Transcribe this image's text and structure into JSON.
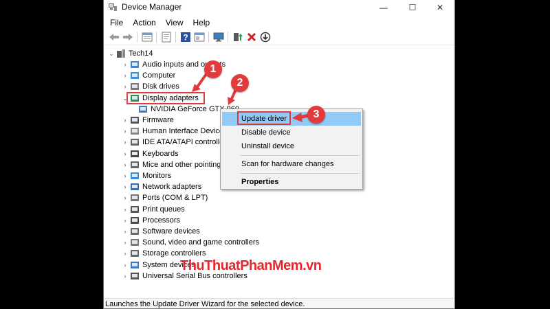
{
  "window": {
    "title": "Device Manager",
    "minimize_glyph": "—",
    "maximize_glyph": "☐",
    "close_glyph": "✕"
  },
  "menu": [
    "File",
    "Action",
    "View",
    "Help"
  ],
  "toolbar": {
    "icons": [
      "back-icon",
      "forward-icon",
      "properties-icon",
      "view-icon",
      "help-icon",
      "view-icon-2",
      "monitor-icon",
      "update-driver-icon",
      "uninstall-icon",
      "download-icon"
    ]
  },
  "tree": {
    "root": "Tech14",
    "items": [
      {
        "label": "Audio inputs and outputs",
        "chevron": "›"
      },
      {
        "label": "Computer",
        "chevron": "›"
      },
      {
        "label": "Disk drives",
        "chevron": "›"
      },
      {
        "label": "Display adapters",
        "chevron": "⌄",
        "expanded": true
      },
      {
        "label": "NVIDIA GeForce GTX 960",
        "child": true
      },
      {
        "label": "Firmware",
        "chevron": "›"
      },
      {
        "label": "Human Interface Devices",
        "chevron": "›"
      },
      {
        "label": "IDE ATA/ATAPI controllers",
        "chevron": "›"
      },
      {
        "label": "Keyboards",
        "chevron": "›"
      },
      {
        "label": "Mice and other pointing devices",
        "chevron": "›"
      },
      {
        "label": "Monitors",
        "chevron": "›"
      },
      {
        "label": "Network adapters",
        "chevron": "›"
      },
      {
        "label": "Ports (COM & LPT)",
        "chevron": "›"
      },
      {
        "label": "Print queues",
        "chevron": "›"
      },
      {
        "label": "Processors",
        "chevron": "›"
      },
      {
        "label": "Software devices",
        "chevron": "›"
      },
      {
        "label": "Sound, video and game controllers",
        "chevron": "›"
      },
      {
        "label": "Storage controllers",
        "chevron": "›"
      },
      {
        "label": "System devices",
        "chevron": "›"
      },
      {
        "label": "Universal Serial Bus controllers",
        "chevron": "›"
      }
    ]
  },
  "context_menu": {
    "update_driver": "Update driver",
    "disable_device": "Disable device",
    "uninstall_device": "Uninstall device",
    "scan": "Scan for hardware changes",
    "properties": "Properties"
  },
  "annotations": {
    "step1": "1",
    "step2": "2",
    "step3": "3"
  },
  "status": "Launches the Update Driver Wizard for the selected device.",
  "watermark": {
    "part1": "ThuThuat",
    "part2": "PhanMem",
    "part3": ".vn"
  },
  "colors": {
    "accent_red": "#e03a3a",
    "selection_blue": "#91c9f7"
  }
}
